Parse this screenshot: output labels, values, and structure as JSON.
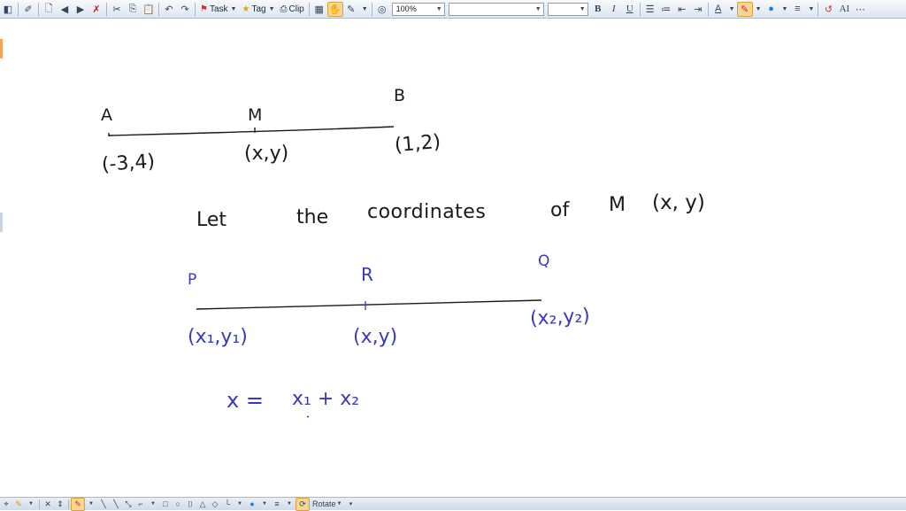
{
  "toolbar": {
    "task_label": "Task",
    "tag_label": "Tag",
    "clip_label": "Clip",
    "zoom_value": "100%",
    "font_name_value": "",
    "font_size_value": "",
    "bold_label": "B",
    "italic_label": "I",
    "underline_label": "U"
  },
  "bottom_toolbar": {
    "rotate_label": "Rotate"
  },
  "colors": {
    "ink_black": "#1a1a1a",
    "ink_blue": "#3a3ab8",
    "toolbar_bg": "#dde6f1"
  },
  "canvas": {
    "diagram1": {
      "point_a_label": "A",
      "point_m_label": "M",
      "point_b_label": "B",
      "point_a_coords": "(-3,4)",
      "point_m_coords": "(x,y)",
      "point_b_coords": "(1,2)"
    },
    "statement": {
      "w1": "Let",
      "w2": "the",
      "w3": "coordinates",
      "w4": "of",
      "w5": "M",
      "w6": "(x, y)"
    },
    "diagram2": {
      "point_p_label": "P",
      "point_r_label": "R",
      "point_q_label": "Q",
      "point_p_coords": "(x₁,y₁)",
      "point_r_coords": "(x,y)",
      "point_q_coords": "(x₂,y₂)"
    },
    "formula": {
      "lhs": "x =",
      "rhs": "x₁ + x₂"
    }
  }
}
